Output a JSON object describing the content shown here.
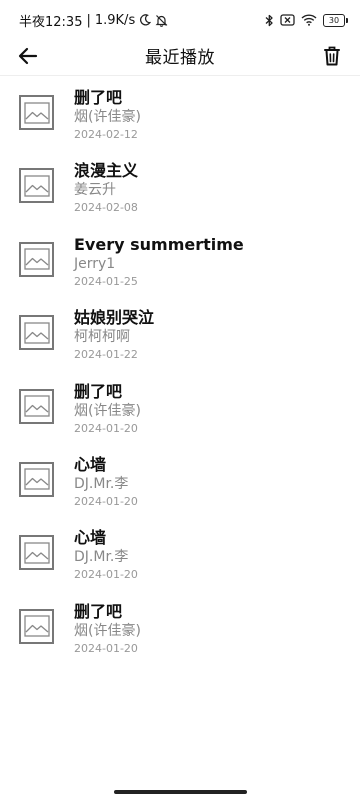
{
  "status_bar": {
    "time_text": "半夜12:35",
    "separator": "|",
    "network_speed": "1.9K/s",
    "battery_level": "30",
    "icons": [
      "moon-icon",
      "bell-off-icon",
      "bluetooth-icon",
      "sim-off-icon",
      "wifi-icon",
      "battery-icon"
    ]
  },
  "header": {
    "title": "最近播放",
    "back_icon": "arrow-left-icon",
    "delete_icon": "trash-icon"
  },
  "songs": [
    {
      "title": "删了吧",
      "artist": "烟(许佳豪)",
      "date": "2024-02-12"
    },
    {
      "title": "浪漫主义",
      "artist": "姜云升",
      "date": "2024-02-08"
    },
    {
      "title": "Every summertime",
      "artist": "Jerry1",
      "date": "2024-01-25"
    },
    {
      "title": "姑娘别哭泣",
      "artist": "柯柯柯啊",
      "date": "2024-01-22"
    },
    {
      "title": "删了吧",
      "artist": "烟(许佳豪)",
      "date": "2024-01-20"
    },
    {
      "title": "心墙",
      "artist": "DJ.Mr.李",
      "date": "2024-01-20"
    },
    {
      "title": "心墙",
      "artist": "DJ.Mr.李",
      "date": "2024-01-20"
    },
    {
      "title": "删了吧",
      "artist": "烟(许佳豪)",
      "date": "2024-01-20"
    }
  ],
  "colors": {
    "title_text": "#111111",
    "artist_text": "#888888",
    "date_text": "#999999",
    "thumbnail_border": "#777777"
  }
}
